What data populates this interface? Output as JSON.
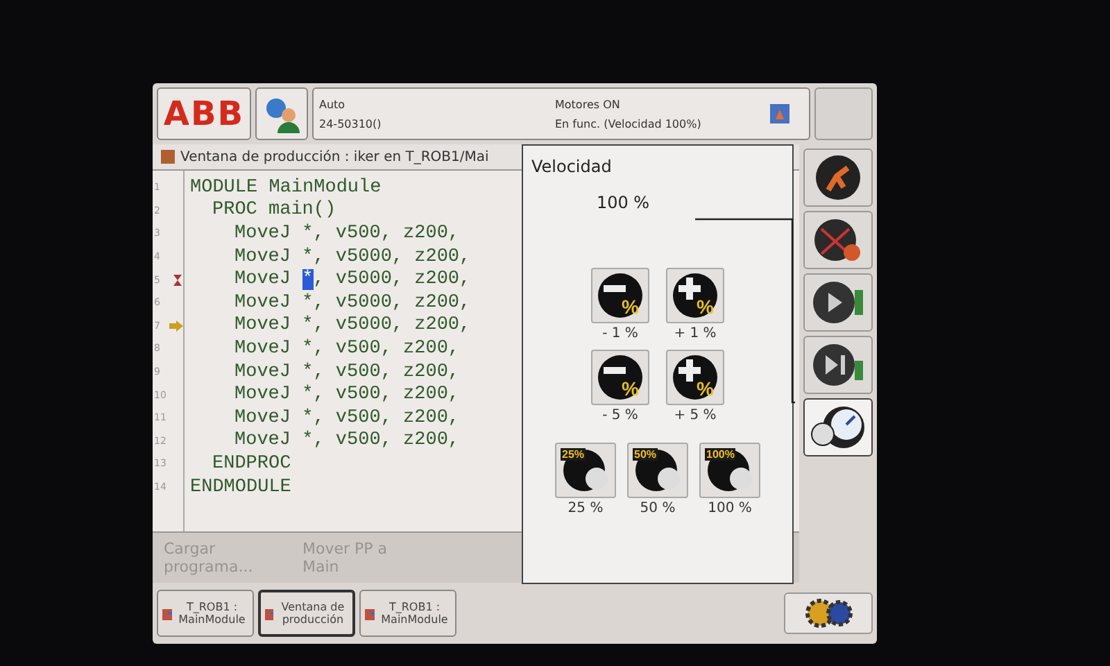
{
  "status_bar": {
    "logo": "ABB",
    "mode": "Auto",
    "controller": "24-50310()",
    "motors": "Motores ON",
    "state": "En func. (Velocidad 100%)"
  },
  "editor": {
    "title": "Ventana de producción : iker en T_ROB1/Mai",
    "lines": [
      {
        "number": "1",
        "kind": "statement",
        "text": "MODULE MainModule",
        "children": [
          {
            "number": "2",
            "kind": "statement",
            "text": "PROC main()",
            "children": [
              {
                "number": "3",
                "kind": "move",
                "instruction": "MoveJ",
                "target": "*",
                "target_selected": false,
                "args": ", v500, z200,"
              },
              {
                "number": "4",
                "kind": "move",
                "instruction": "MoveJ",
                "target": "*",
                "target_selected": false,
                "args": ", v5000, z200,"
              },
              {
                "number": "5",
                "kind": "move",
                "instruction": "MoveJ",
                "target": "*",
                "target_selected": true,
                "args": ", v5000, z200,",
                "motion_pointer": true
              },
              {
                "number": "6",
                "kind": "move",
                "instruction": "MoveJ",
                "target": "*",
                "target_selected": false,
                "args": ", v5000, z200,"
              },
              {
                "number": "7",
                "kind": "move",
                "instruction": "MoveJ",
                "target": "*",
                "target_selected": false,
                "args": ", v5000, z200,",
                "program_pointer": true
              },
              {
                "number": "8",
                "kind": "move",
                "instruction": "MoveJ",
                "target": "*",
                "target_selected": false,
                "args": ", v500, z200,"
              },
              {
                "number": "9",
                "kind": "move",
                "instruction": "MoveJ",
                "target": "*",
                "target_selected": false,
                "args": ", v500, z200,"
              },
              {
                "number": "10",
                "kind": "move",
                "instruction": "MoveJ",
                "target": "*",
                "target_selected": false,
                "args": ", v500, z200,"
              },
              {
                "number": "11",
                "kind": "move",
                "instruction": "MoveJ",
                "target": "*",
                "target_selected": false,
                "args": ", v500, z200,"
              },
              {
                "number": "12",
                "kind": "move",
                "instruction": "MoveJ",
                "target": "*",
                "target_selected": false,
                "args": ", v500, z200,"
              }
            ]
          },
          {
            "number": "13",
            "kind": "statement",
            "text": "ENDPROC"
          }
        ]
      },
      {
        "number": "14",
        "kind": "statement",
        "text": "ENDMODULE"
      }
    ],
    "buttons": [
      {
        "label": "Cargar programa...",
        "disabled": true
      },
      {
        "label": "Mover PP a Main",
        "disabled": true
      }
    ]
  },
  "speed_panel": {
    "title": "Velocidad",
    "value": "100 %",
    "steps": [
      {
        "kind": "minus",
        "symbol": "%",
        "label": "- 1 %"
      },
      {
        "kind": "plus",
        "symbol": "%",
        "label": "+ 1 %"
      },
      {
        "kind": "minus",
        "symbol": "%",
        "label": "- 5 %"
      },
      {
        "kind": "plus",
        "symbol": "%",
        "label": "+ 5 %"
      }
    ],
    "presets": [
      {
        "badge": "25%",
        "label": "25 %"
      },
      {
        "badge": "50%",
        "label": "50 %"
      },
      {
        "badge": "100%",
        "label": "100 %"
      }
    ]
  },
  "quickset": [
    {
      "kind": "mechanical_unit",
      "selected": false
    },
    {
      "kind": "increment",
      "selected": false
    },
    {
      "kind": "run_mode",
      "selected": false
    },
    {
      "kind": "step_mode",
      "selected": false
    },
    {
      "kind": "speed",
      "selected": true
    }
  ],
  "taskbar": [
    {
      "label": "T_ROB1 : MainModule",
      "selected": false
    },
    {
      "label": "Ventana de producción",
      "selected": true
    },
    {
      "label": "T_ROB1 : MainModule",
      "selected": false
    }
  ]
}
